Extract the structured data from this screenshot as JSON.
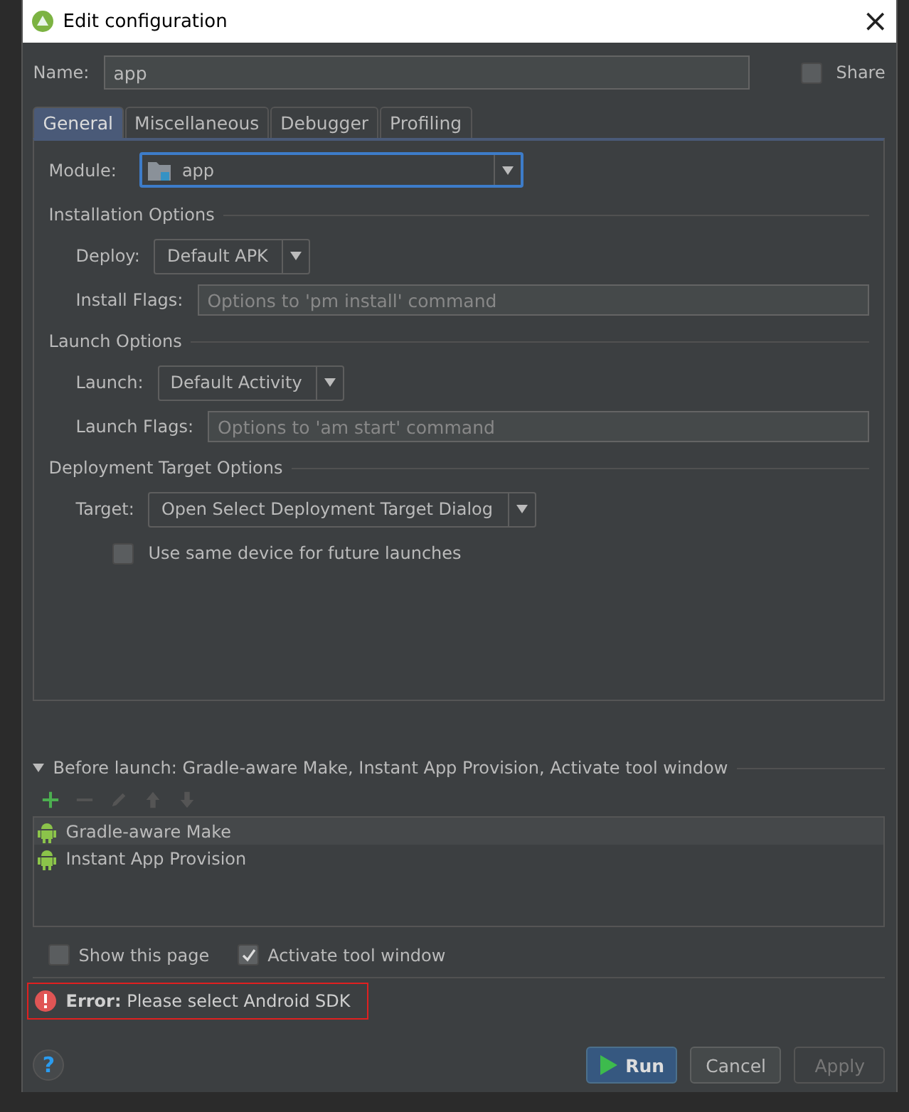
{
  "window": {
    "title": "Edit configuration",
    "close": "×"
  },
  "name": {
    "label": "Name:",
    "value": "app"
  },
  "share": {
    "label": "Share",
    "checked": false
  },
  "tabs": [
    {
      "label": "General",
      "selected": true
    },
    {
      "label": "Miscellaneous",
      "selected": false
    },
    {
      "label": "Debugger",
      "selected": false
    },
    {
      "label": "Profiling",
      "selected": false
    }
  ],
  "module": {
    "label": "Module:",
    "value": "app"
  },
  "sections": [
    {
      "title": "Installation Options",
      "fields": [
        {
          "kind": "select",
          "label": "Deploy:",
          "value": "Default APK"
        },
        {
          "kind": "text",
          "label": "Install Flags:",
          "placeholder": "Options to 'pm install' command"
        }
      ]
    },
    {
      "title": "Launch Options",
      "fields": [
        {
          "kind": "select",
          "label": "Launch:",
          "value": "Default Activity"
        },
        {
          "kind": "text",
          "label": "Launch Flags:",
          "placeholder": "Options to 'am start' command"
        }
      ]
    },
    {
      "title": "Deployment Target Options",
      "fields": [
        {
          "kind": "select",
          "label": "Target:",
          "value": "Open Select Deployment Target Dialog"
        },
        {
          "kind": "checkbox",
          "label": "Use same device for future launches",
          "checked": false
        }
      ]
    }
  ],
  "before_launch": {
    "title": "Before launch: Gradle-aware Make, Instant App Provision, Activate tool window",
    "expanded": true,
    "tasks": [
      {
        "label": "Gradle-aware Make",
        "selected": true
      },
      {
        "label": "Instant App Provision",
        "selected": false
      }
    ]
  },
  "options": [
    {
      "label": "Show this page",
      "checked": false
    },
    {
      "label": "Activate tool window",
      "checked": true
    }
  ],
  "error": "**Error:** Please select Android SDK",
  "help": "?",
  "buttons": [
    {
      "label": "Run",
      "kind": "default",
      "disabled": false
    },
    {
      "label": "Cancel",
      "kind": "normal",
      "disabled": false
    },
    {
      "label": "Apply",
      "kind": "normal",
      "disabled": true
    }
  ]
}
